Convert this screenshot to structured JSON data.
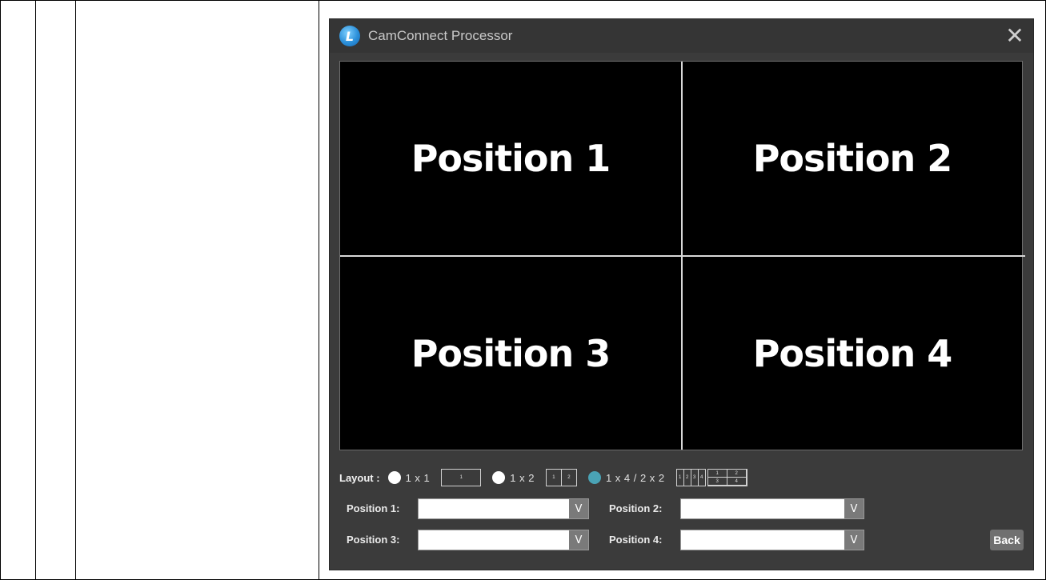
{
  "window": {
    "title": "CamConnect Processor",
    "logo_letter": "L",
    "close_glyph": "✕"
  },
  "grid": {
    "positions": [
      "Position 1",
      "Position 2",
      "Position 3",
      "Position 4"
    ]
  },
  "layout": {
    "label": "Layout :",
    "options": [
      {
        "label": "1 x 1",
        "selected": false,
        "cells": [
          "1"
        ]
      },
      {
        "label": "1 x 2",
        "selected": false,
        "cells": [
          "1",
          "2"
        ]
      },
      {
        "label": "1 x 4 / 2 x 2",
        "selected": true,
        "cells_row": [
          "1",
          "2",
          "3",
          "4"
        ],
        "cells_grid": [
          "1",
          "2",
          "3",
          "4"
        ]
      }
    ],
    "selected_color": "#4aa3b5"
  },
  "selects": [
    {
      "label": "Position 1:",
      "value": ""
    },
    {
      "label": "Position 2:",
      "value": ""
    },
    {
      "label": "Position 3:",
      "value": ""
    },
    {
      "label": "Position 4:",
      "value": ""
    }
  ],
  "dropdown_glyph": "V",
  "back_label": "Back"
}
